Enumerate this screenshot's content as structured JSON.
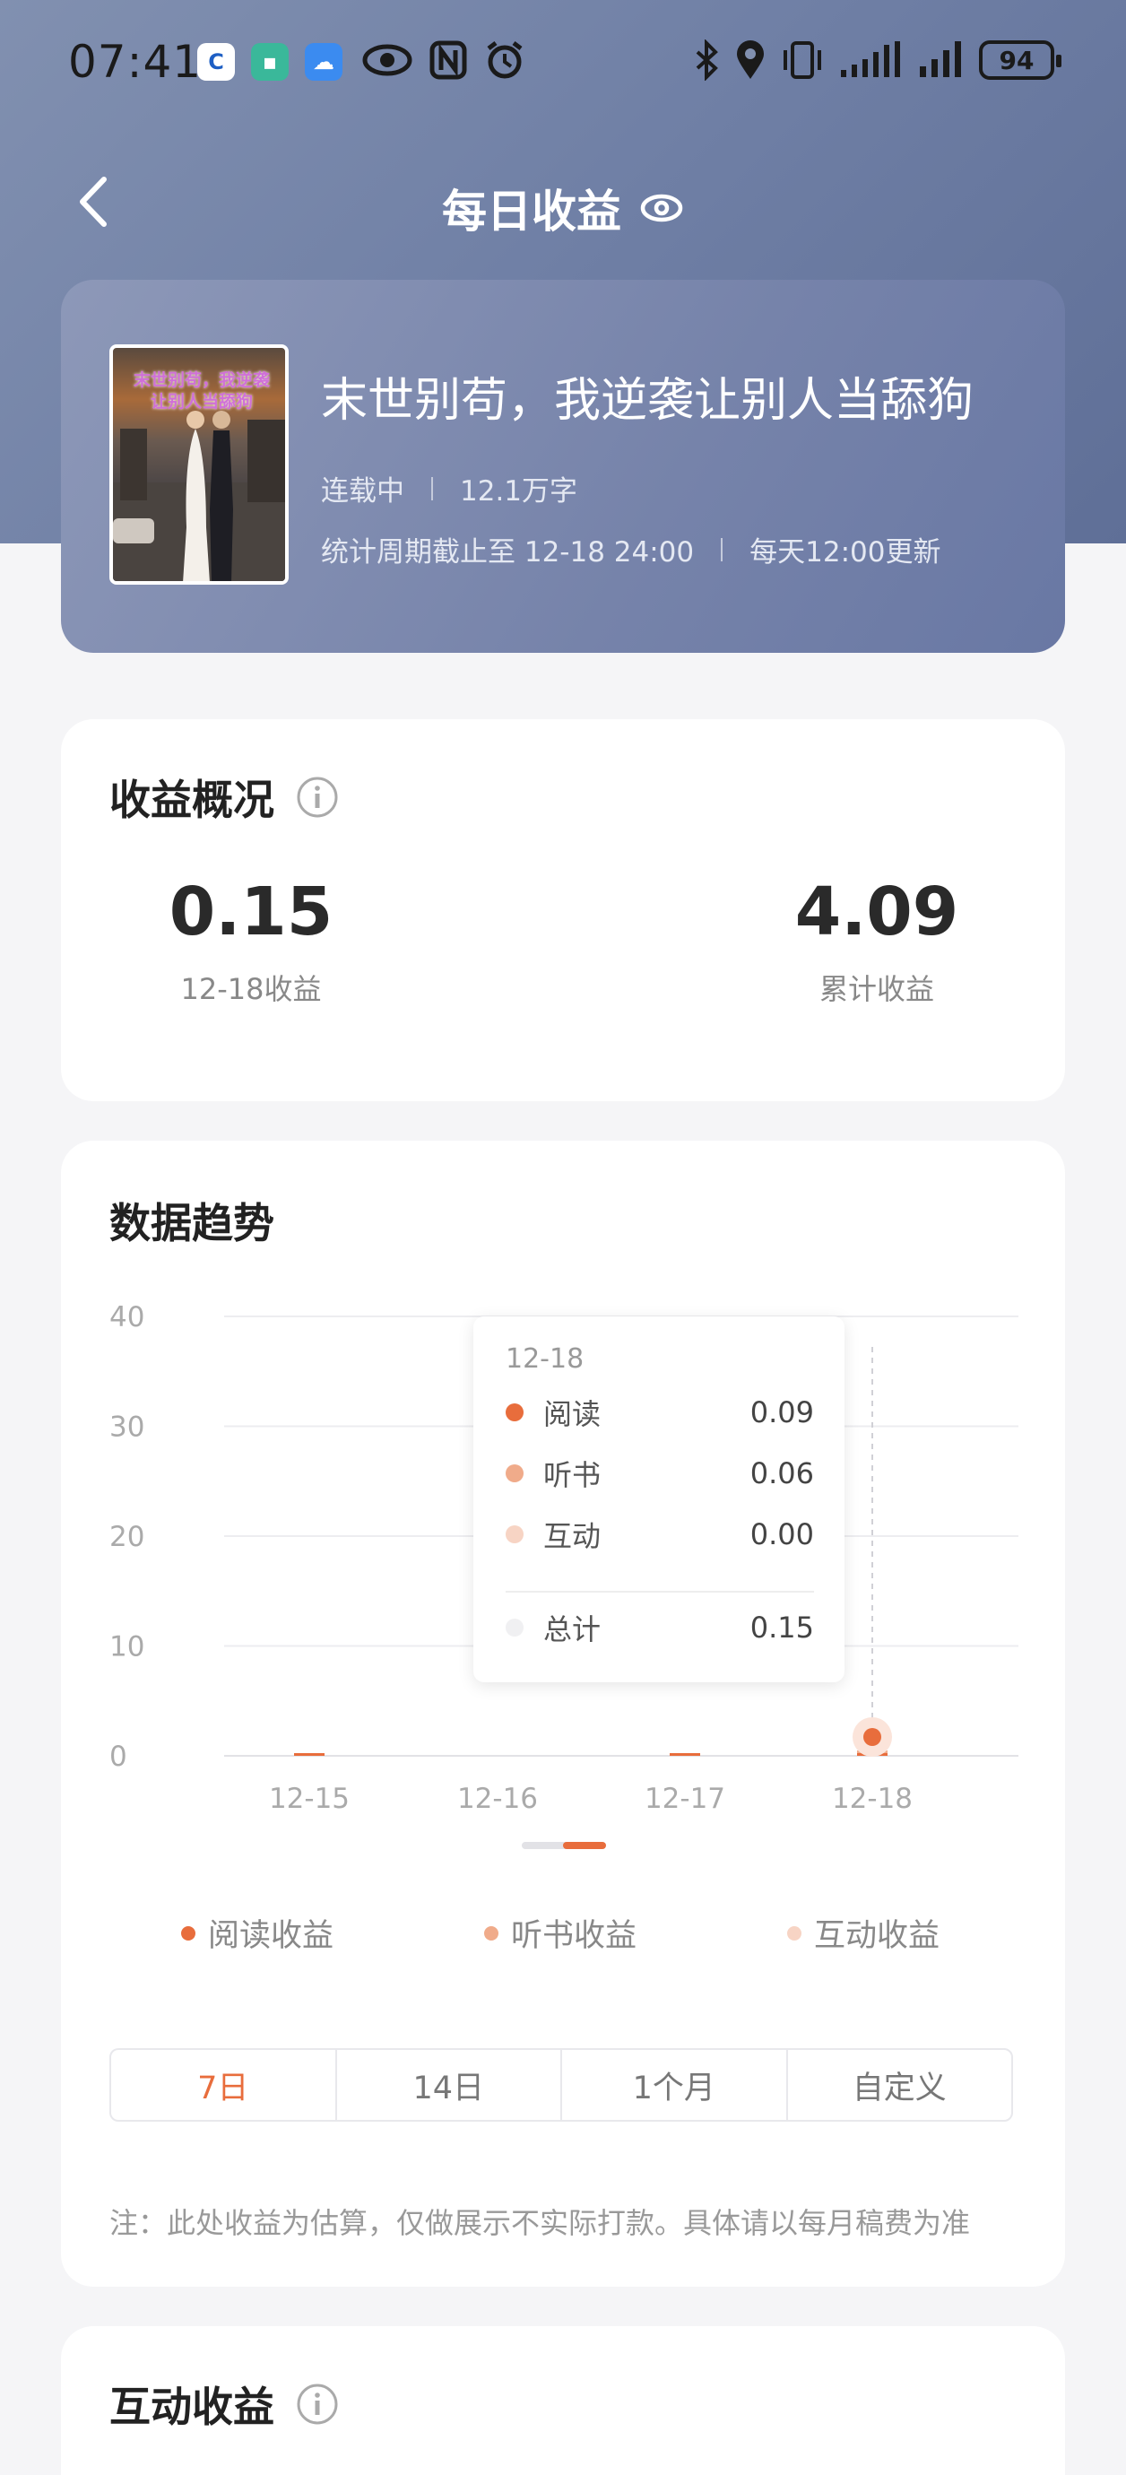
{
  "status_bar": {
    "time": "07:41",
    "battery": "94",
    "app_icons": [
      "app-c-icon",
      "app-shield-icon",
      "weather-icon"
    ],
    "system_icons": [
      "eye-icon",
      "nfc-icon",
      "alarm-icon",
      "bluetooth-icon",
      "location-icon",
      "vibrate-icon",
      "signal-icon",
      "signal-icon"
    ]
  },
  "header": {
    "title": "每日收益"
  },
  "book": {
    "cover_title": "末世别苟，我逆袭让别人当舔狗",
    "title": "末世别苟，我逆袭让别人当舔狗",
    "status": "连载中",
    "word_count": "12.1万字",
    "period": "统计周期截止至 12-18 24:00",
    "update": "每天12:00更新"
  },
  "overview": {
    "title": "收益概况",
    "daily_value": "0.15",
    "daily_label": "12-18收益",
    "total_value": "4.09",
    "total_label": "累计收益"
  },
  "trend": {
    "title": "数据趋势",
    "tooltip": {
      "date": "12-18",
      "rows": [
        {
          "label": "阅读",
          "value": "0.09"
        },
        {
          "label": "听书",
          "value": "0.06"
        },
        {
          "label": "互动",
          "value": "0.00"
        }
      ],
      "total_label": "总计",
      "total_value": "0.15"
    },
    "legend": [
      "阅读收益",
      "听书收益",
      "互动收益"
    ],
    "ranges": [
      "7日",
      "14日",
      "1个月",
      "自定义"
    ],
    "active_range": "7日",
    "note": "注：此处收益为估算，仅做展示不实际打款。具体请以每月稿费为准"
  },
  "interaction": {
    "title": "互动收益"
  },
  "colors": {
    "accent": "#e86d3c",
    "reading": "#e86d3c",
    "listening": "#f0ab8a",
    "interaction": "#f7d4c4",
    "total": "#f0f0f2"
  },
  "chart_data": {
    "type": "bar",
    "categories": [
      "12-15",
      "12-16",
      "12-17",
      "12-18"
    ],
    "series": [
      {
        "name": "阅读收益",
        "values": [
          0.09,
          0,
          0.09,
          0.09
        ]
      },
      {
        "name": "听书收益",
        "values": [
          0,
          0,
          0,
          0.06
        ]
      },
      {
        "name": "互动收益",
        "values": [
          0,
          0,
          0,
          0
        ]
      }
    ],
    "y_ticks": [
      "40",
      "30",
      "20",
      "10",
      "0"
    ],
    "ylim": [
      0,
      40
    ],
    "grid": true,
    "legend_position": "bottom",
    "highlight_category": "12-18"
  }
}
